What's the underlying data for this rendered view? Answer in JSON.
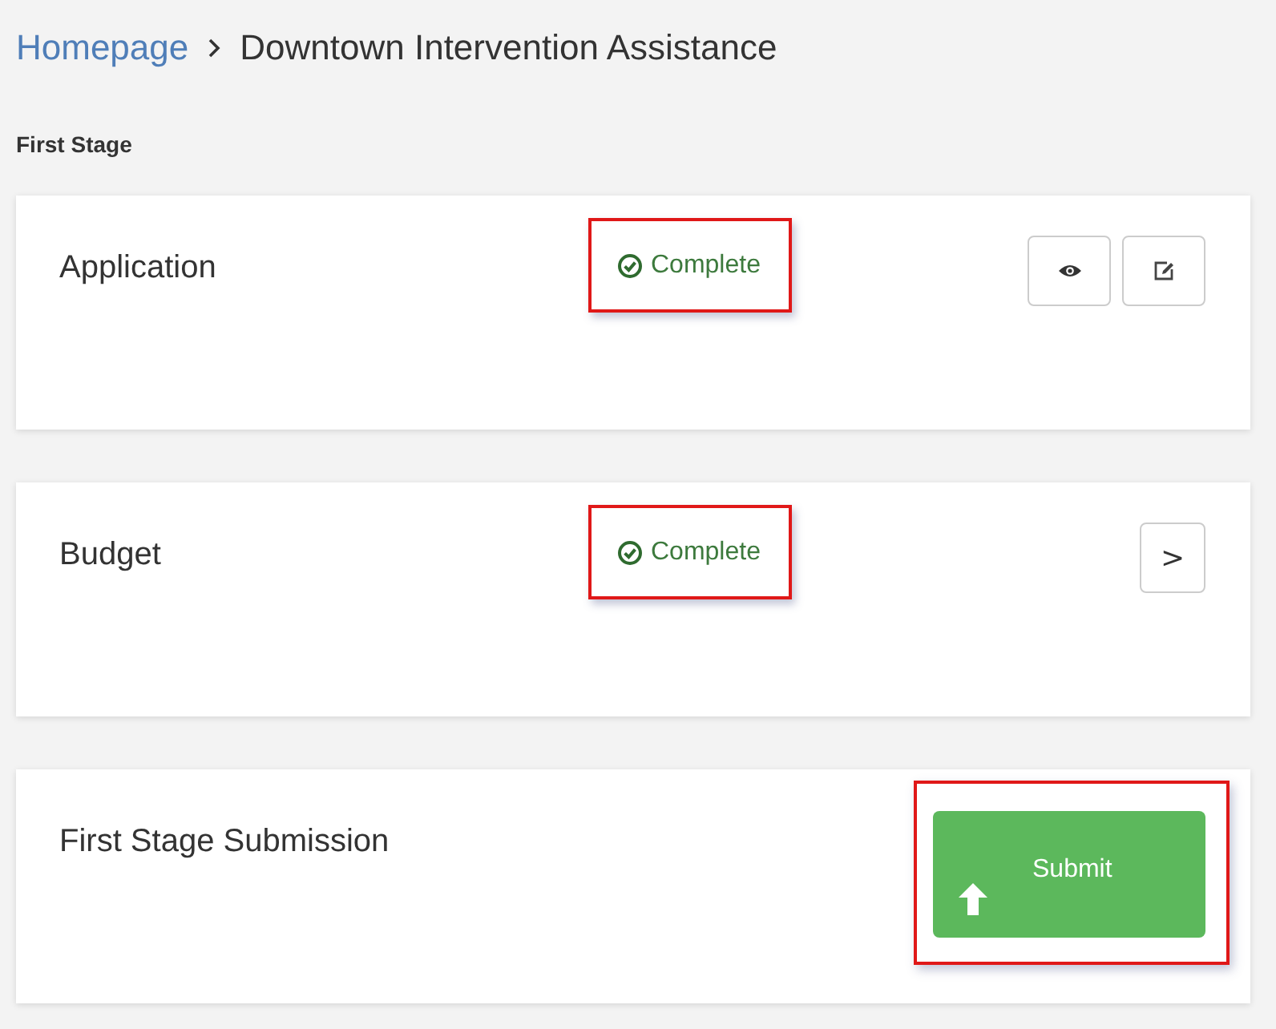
{
  "breadcrumb": [
    {
      "label": "Homepage",
      "kind": "link"
    },
    {
      "label": "Downtown Intervention Assistance",
      "kind": "current"
    }
  ],
  "section_title": "First Stage",
  "cards": [
    {
      "title": "Application",
      "status": {
        "label": "Complete",
        "highlighted": true
      },
      "actions": [
        {
          "kind": "view"
        },
        {
          "kind": "edit"
        }
      ]
    },
    {
      "title": "Budget",
      "status": {
        "label": "Complete",
        "highlighted": true
      },
      "actions": [
        {
          "kind": "next",
          "label": ">"
        }
      ]
    },
    {
      "title": "First Stage Submission",
      "actions": [
        {
          "kind": "submit",
          "label": "Submit",
          "highlighted": true
        }
      ]
    }
  ]
}
